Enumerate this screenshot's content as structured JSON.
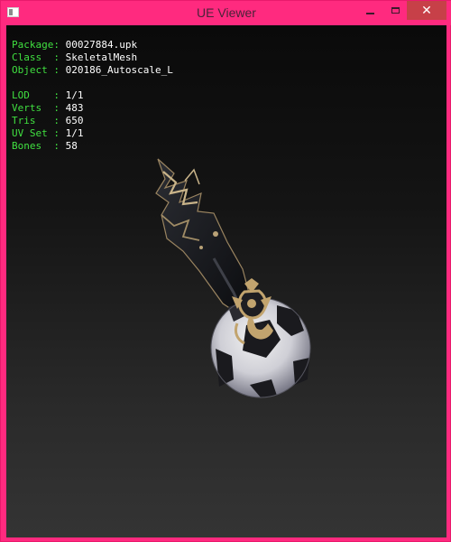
{
  "window": {
    "title": "UE Viewer",
    "controls": {
      "minimize": "minimize-icon",
      "maximize": "maximize-icon",
      "close": "close-icon"
    }
  },
  "info": {
    "package_key": "Package:",
    "package_value": "00027884.upk",
    "class_key": "Class  :",
    "class_value": "SkeletalMesh",
    "object_key": "Object :",
    "object_value": "020186_Autoscale_L",
    "lod_key": "LOD    :",
    "lod_value": "1/1",
    "verts_key": "Verts  :",
    "verts_value": "483",
    "tris_key": "Tris   :",
    "tris_value": "650",
    "uvset_key": "UV Set :",
    "uvset_value": "1/1",
    "bones_key": "Bones  :",
    "bones_value": "58"
  },
  "colors": {
    "titlebar": "#ff2a7f",
    "close_button": "#c74048",
    "label_green": "#40e040",
    "value_white": "#ffffff"
  }
}
